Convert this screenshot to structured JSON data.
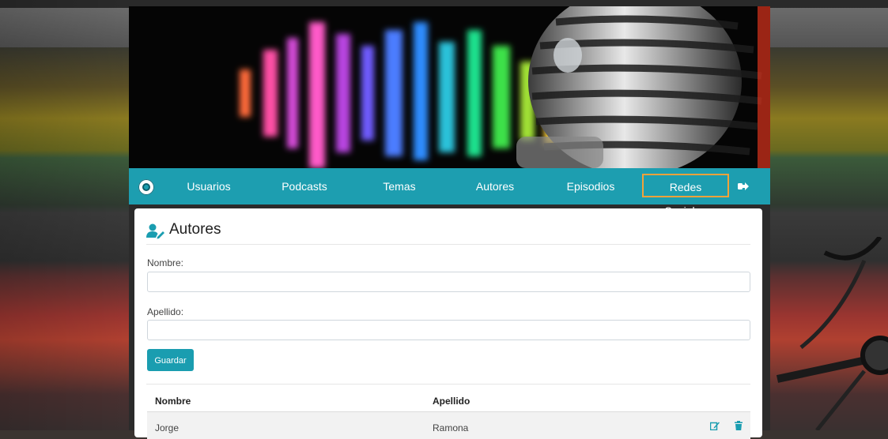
{
  "colors": {
    "navbar": "#1d9eb0",
    "active_border": "#f2a23a",
    "button": "#1a9db0",
    "icon": "#1a9db0"
  },
  "nav": {
    "logo_icon": "podcast-logo-icon",
    "items": [
      {
        "label": "Usuarios"
      },
      {
        "label": "Podcasts"
      },
      {
        "label": "Temas"
      },
      {
        "label": "Autores"
      },
      {
        "label": "Episodios"
      },
      {
        "label": "Redes Sociales",
        "active": true
      }
    ],
    "logout_icon": "sign-out-icon"
  },
  "page": {
    "title": "Autores",
    "title_icon": "user-edit-icon"
  },
  "form": {
    "nombre_label": "Nombre:",
    "nombre_value": "",
    "apellido_label": "Apellido:",
    "apellido_value": "",
    "save_label": "Guardar"
  },
  "table": {
    "headers": [
      "Nombre",
      "Apellido"
    ],
    "rows": [
      {
        "nombre": "Jorge",
        "apellido": "Ramona"
      }
    ],
    "row_actions": [
      "edit-icon",
      "trash-icon"
    ]
  }
}
